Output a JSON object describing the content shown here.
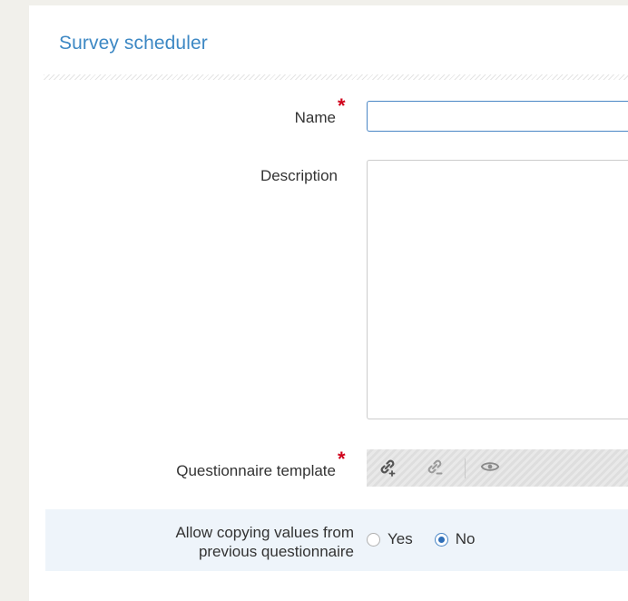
{
  "form": {
    "title": "Survey scheduler",
    "name_label": "Name",
    "name_value": "",
    "description_label": "Description",
    "description_value": "",
    "template_label": "Questionnaire template",
    "required_marker": "*",
    "allow_label_line1": "Allow copying values from",
    "allow_label_line2": "previous questionnaire",
    "options": {
      "yes": "Yes",
      "no": "No"
    },
    "selected_option": "No"
  },
  "icons": {
    "link_add": "link-add-icon",
    "link_remove": "link-remove-icon",
    "preview": "eye-icon"
  },
  "colors": {
    "accent": "#3d88c4",
    "required": "#d0021b",
    "background": "#f1f0eb",
    "row_highlight": "#eef4fa"
  }
}
